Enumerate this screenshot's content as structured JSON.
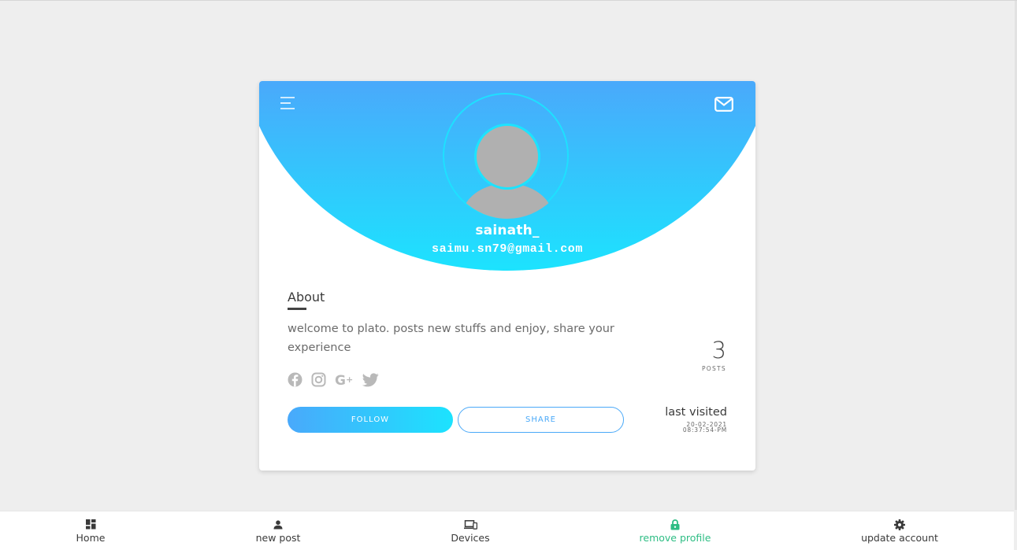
{
  "profile": {
    "username": "sainath_",
    "email": "saimu.sn79@gmail.com"
  },
  "about": {
    "title": "About",
    "text": "welcome to plato. posts new stuffs and enjoy, share your experience"
  },
  "social_icons": [
    "facebook-icon",
    "instagram-icon",
    "google-plus-icon",
    "twitter-icon"
  ],
  "stats": {
    "posts_count": "3",
    "posts_label": "POSTS"
  },
  "buttons": {
    "follow": "FOLLOW",
    "share": "SHARE"
  },
  "last_visited": {
    "title": "last visited",
    "date": "20-02-2021",
    "time": "08:37:54-PM"
  },
  "nav": [
    {
      "label": "Home",
      "icon": "dashboard-icon"
    },
    {
      "label": "new post",
      "icon": "person-icon"
    },
    {
      "label": "Devices",
      "icon": "devices-icon"
    },
    {
      "label": "remove profile",
      "icon": "lock-icon",
      "active": true
    },
    {
      "label": "update account",
      "icon": "gear-icon"
    }
  ],
  "colors": {
    "gradient_top": "#4aa9fb",
    "gradient_bottom": "#1ce3fe",
    "active_nav": "#2ebd84",
    "background": "#eeeeee"
  }
}
